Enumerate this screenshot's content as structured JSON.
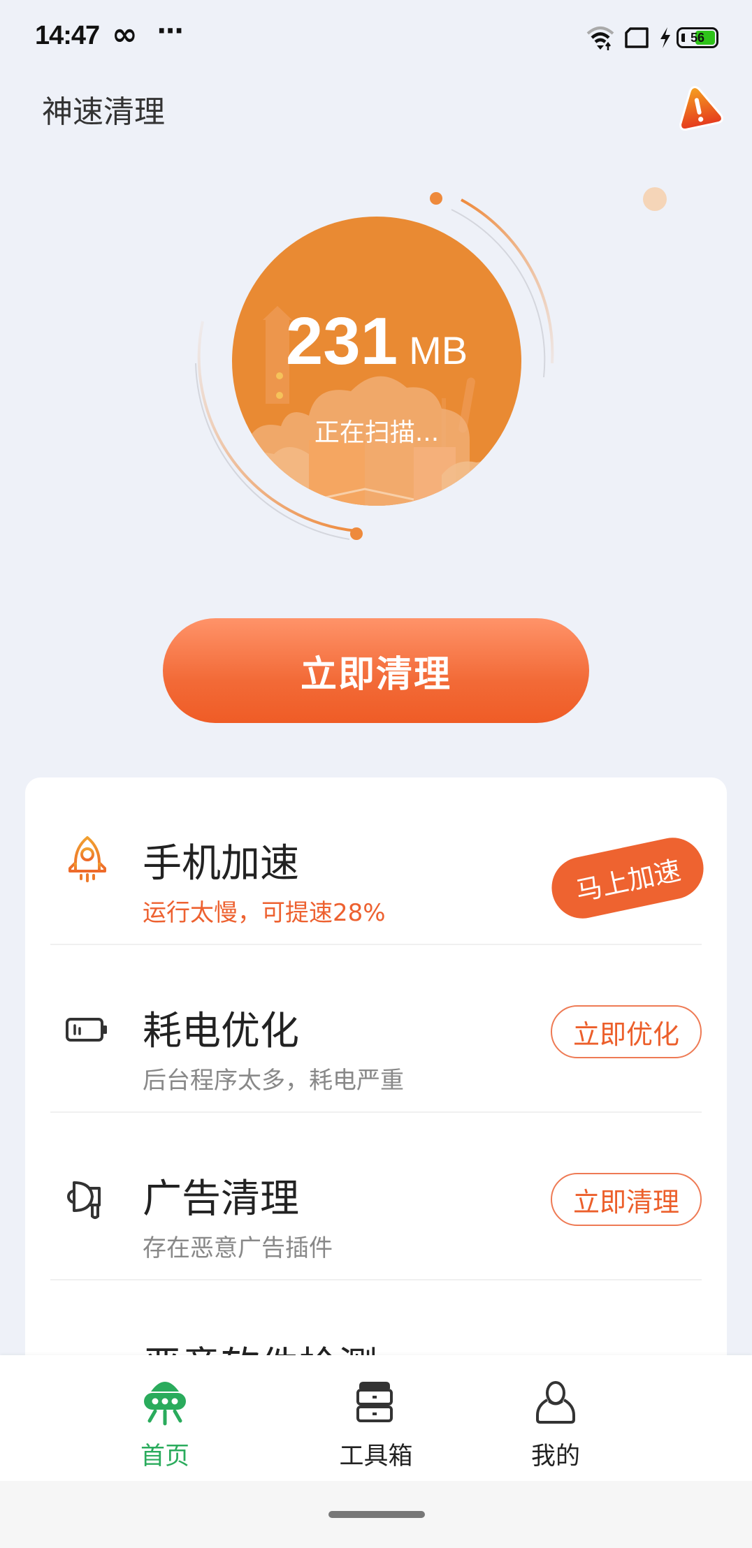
{
  "status_bar": {
    "time": "14:47",
    "infinity_glyph": "∞",
    "more_glyph": "···",
    "icons": [
      "wifi-icon",
      "sim-card-icon",
      "charging-bolt-icon",
      "battery-icon"
    ],
    "battery_level": "56",
    "battery_fraction": 0.56,
    "battery_color": "#2ec31a"
  },
  "header": {
    "title": "神速清理",
    "warning_icon": "warning-triangle-icon"
  },
  "scan": {
    "value": "231",
    "unit": "MB",
    "status": "正在扫描..."
  },
  "main_button": {
    "label": "立即清理"
  },
  "features": [
    {
      "icon": "rocket-icon",
      "title": "手机加速",
      "subtitle": "运行太慢，可提速28%",
      "subtitle_alert": true,
      "action": "马上加速",
      "action_style": "filled"
    },
    {
      "icon": "battery-low-icon",
      "title": "耗电优化",
      "subtitle": "后台程序太多，耗电严重",
      "subtitle_alert": false,
      "action": "立即优化",
      "action_style": "outline"
    },
    {
      "icon": "megaphone-icon",
      "title": "广告清理",
      "subtitle": "存在恶意广告插件",
      "subtitle_alert": false,
      "action": "立即清理",
      "action_style": "outline"
    },
    {
      "icon": "shield-scan-icon",
      "title": "恶意软件检测",
      "subtitle": "",
      "subtitle_alert": false,
      "action": "",
      "action_style": "outline"
    }
  ],
  "bottom_nav": {
    "items": [
      {
        "label": "首页",
        "icon": "ufo-home-icon",
        "active": true
      },
      {
        "label": "工具箱",
        "icon": "toolbox-drawer-icon",
        "active": false
      },
      {
        "label": "我的",
        "icon": "user-profile-icon",
        "active": false
      }
    ]
  },
  "colors": {
    "accent_orange": "#ee6330",
    "scan_circle": "#e98a33",
    "nav_active_green": "#2aab5c",
    "background": "#eef1f8"
  }
}
